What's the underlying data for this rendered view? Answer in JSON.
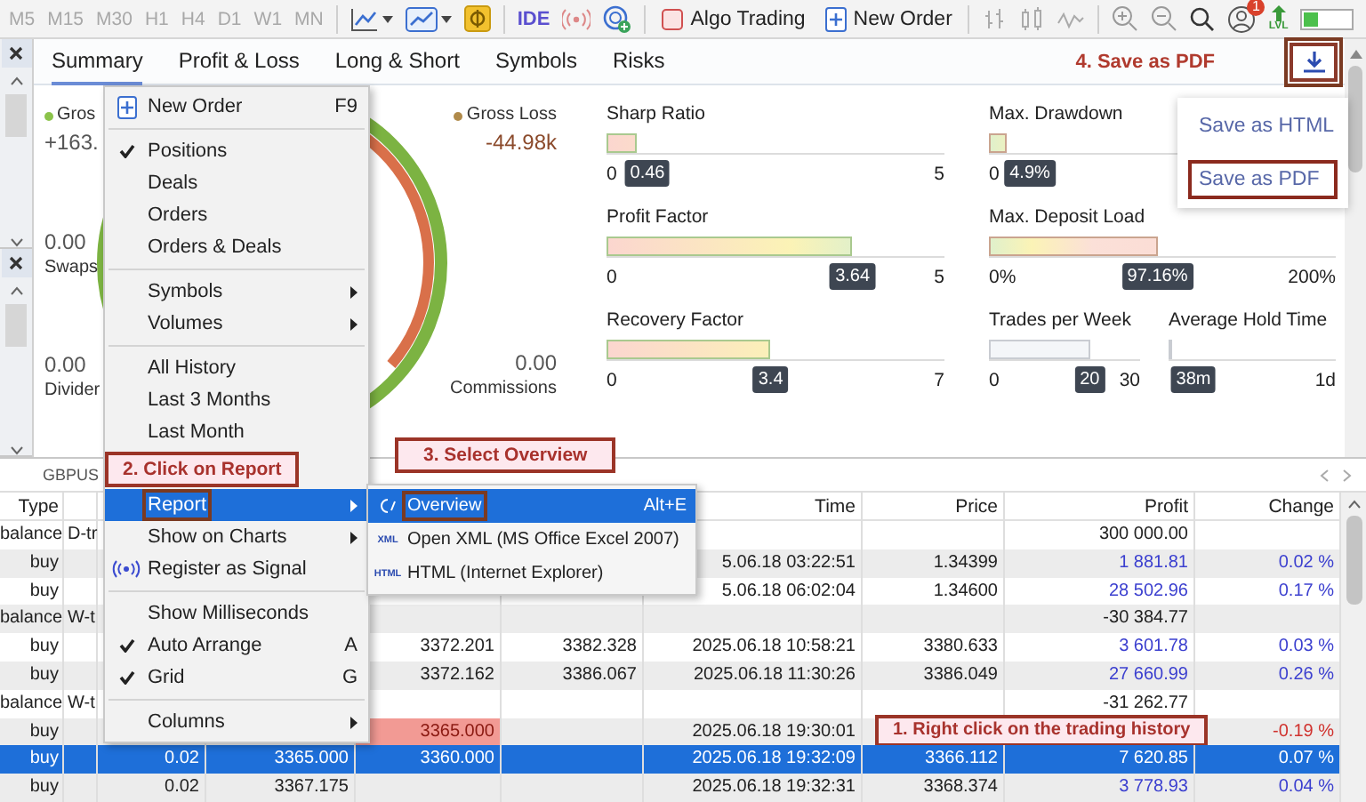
{
  "toolbar": {
    "timeframes": [
      "M5",
      "M15",
      "M30",
      "H1",
      "H4",
      "D1",
      "W1",
      "MN"
    ],
    "ide_label": "IDE",
    "algo_trading": "Algo Trading",
    "new_order": "New Order",
    "notification_count": "1",
    "level_label": "LVL"
  },
  "report": {
    "tabs": [
      {
        "label": "Summary",
        "selected": true
      },
      {
        "label": "Profit & Loss",
        "selected": false
      },
      {
        "label": "Long & Short",
        "selected": false
      },
      {
        "label": "Symbols",
        "selected": false
      },
      {
        "label": "Risks",
        "selected": false
      }
    ],
    "callout": "4. Save as PDF",
    "download_outlined": true,
    "summary": {
      "gross_profit_label": "Gros",
      "gross_profit_value": "+163.",
      "swaps_value": "0.00",
      "swaps_label": "Swaps",
      "dividends_value": "0.00",
      "dividends_label": "Divider",
      "gross_loss_label": "Gross Loss",
      "gross_loss_value": "-44.98k",
      "commissions_value": "0.00",
      "commissions_label": "Commissions"
    },
    "metrics": [
      {
        "label": "Sharp Ratio",
        "value": "0.46",
        "min": "0",
        "max": "5",
        "level": 0.092,
        "kind": "rising"
      },
      {
        "label": "Max. Drawdown",
        "value": "4.9%",
        "min": "0",
        "level": 0.05,
        "kind": "falling"
      },
      {
        "label": "Profit Factor",
        "value": "3.64",
        "min": "0",
        "max": "5",
        "level": 0.728,
        "kind": "rising"
      },
      {
        "label": "Max. Deposit Load",
        "value": "97.16%",
        "min": "0%",
        "max": "200%",
        "level": 0.486,
        "kind": "falling"
      },
      {
        "label": "Recovery Factor",
        "value": "3.4",
        "min": "0",
        "max": "7",
        "level": 0.486,
        "kind": "rising"
      },
      {
        "label": "Trades per Week",
        "value": "20",
        "min": "0",
        "max": "30",
        "level": 0.667,
        "kind": "neutral"
      },
      {
        "label": "Average Hold Time",
        "value": "38m",
        "max": "1d",
        "level": 0.026,
        "kind": "neutral"
      }
    ],
    "save_menu": [
      {
        "label": "Save as HTML",
        "outlined": false
      },
      {
        "label": "Save as PDF",
        "outlined": true
      }
    ]
  },
  "context_menu": [
    {
      "kind": "order_item",
      "label": "New Order",
      "shortcut": "F9",
      "selected": false
    },
    {
      "kind": "separator"
    },
    {
      "kind": "item",
      "label": "Positions",
      "checked": true,
      "selected": false
    },
    {
      "kind": "item",
      "label": "Deals",
      "checked": false,
      "selected": false
    },
    {
      "kind": "item",
      "label": "Orders",
      "checked": false,
      "selected": false
    },
    {
      "kind": "item",
      "label": "Orders & Deals",
      "checked": false,
      "selected": false
    },
    {
      "kind": "separator"
    },
    {
      "kind": "item",
      "label": "Symbols",
      "submenu": true,
      "selected": false
    },
    {
      "kind": "item",
      "label": "Volumes",
      "submenu": true,
      "selected": false
    },
    {
      "kind": "separator"
    },
    {
      "kind": "item",
      "label": "All History",
      "selected": false
    },
    {
      "kind": "item",
      "label": "Last 3 Months",
      "selected": false
    },
    {
      "kind": "item",
      "label": "Last Month",
      "selected": false
    },
    {
      "kind": "callout",
      "label": "2. Click on Report"
    },
    {
      "kind": "item",
      "label": "Report",
      "submenu": true,
      "selected": true,
      "outlined": true
    },
    {
      "kind": "item",
      "label": "Show on Charts",
      "submenu": true,
      "selected": false
    },
    {
      "kind": "signal_item",
      "label": "Register as Signal",
      "selected": false
    },
    {
      "kind": "separator"
    },
    {
      "kind": "item",
      "label": "Show Milliseconds",
      "checked": false,
      "selected": false
    },
    {
      "kind": "item",
      "label": "Auto Arrange",
      "checked": true,
      "shortcut": "A",
      "selected": false
    },
    {
      "kind": "item",
      "label": "Grid",
      "checked": true,
      "shortcut": "G",
      "selected": false
    },
    {
      "kind": "separator"
    },
    {
      "kind": "item",
      "label": "Columns",
      "submenu": true,
      "selected": false
    }
  ],
  "submenu": {
    "callout": "3. Select Overview",
    "items": [
      {
        "kind": "view",
        "label": "Overview",
        "shortcut": "Alt+E",
        "selected": true,
        "outlined": true
      },
      {
        "kind": "export",
        "label": "Open XML (MS Office Excel 2007)",
        "badge": "XML",
        "selected": false,
        "outlined": false
      },
      {
        "kind": "export",
        "label": "HTML (Internet Explorer)",
        "badge": "HTML",
        "selected": false,
        "outlined": false
      }
    ]
  },
  "history": {
    "symbol_tab": "GBPUS",
    "columns": [
      "Type",
      null,
      null,
      null,
      null,
      null,
      "Time",
      "Price",
      "Profit",
      "Change"
    ],
    "rows": [
      {
        "kind": "balance",
        "selected": false,
        "cells": [
          "balance",
          "D-tr",
          null,
          null,
          null,
          null,
          null,
          null,
          "300 000.00",
          null
        ]
      },
      {
        "kind": "buy",
        "selected": false,
        "loss": false,
        "cells": [
          "buy",
          null,
          null,
          null,
          null,
          null,
          "5.06.18 03:22:51",
          "1.34399",
          "1 881.81",
          "0.02 %"
        ]
      },
      {
        "kind": "buy",
        "selected": false,
        "loss": false,
        "cells": [
          "buy",
          null,
          null,
          null,
          null,
          null,
          "5.06.18 06:02:04",
          "1.34600",
          "28 502.96",
          "0.17 %"
        ]
      },
      {
        "kind": "balance",
        "selected": false,
        "cells": [
          "balance",
          "W-t",
          null,
          null,
          null,
          null,
          null,
          null,
          "-30 384.77",
          null
        ]
      },
      {
        "kind": "buy",
        "selected": false,
        "loss": false,
        "cells": [
          "buy",
          null,
          null,
          null,
          "3372.201",
          "3382.328",
          "2025.06.18 10:58:21",
          "3380.633",
          "3 601.78",
          "0.03 %"
        ]
      },
      {
        "kind": "buy",
        "selected": false,
        "loss": false,
        "cells": [
          "buy",
          null,
          null,
          null,
          "3372.162",
          "3386.067",
          "2025.06.18 11:30:26",
          "3386.049",
          "27 660.99",
          "0.26 %"
        ]
      },
      {
        "kind": "balance",
        "selected": false,
        "cells": [
          "balance",
          "W-t",
          null,
          null,
          null,
          null,
          null,
          null,
          "-31 262.77",
          null
        ]
      },
      {
        "kind": "buy",
        "selected": false,
        "loss": true,
        "callout": "1. Right click on the trading history",
        "cells": [
          "buy",
          null,
          null,
          null,
          {
            "text": "3365.000",
            "alert": true
          },
          null,
          "2025.06.18 19:30:01",
          null,
          null,
          "-0.19 %"
        ]
      },
      {
        "kind": "buy",
        "selected": true,
        "loss": false,
        "cells": [
          "buy",
          null,
          "0.02",
          "3365.000",
          "3360.000",
          null,
          "2025.06.18 19:32:09",
          "3366.112",
          "7 620.85",
          "0.07 %"
        ]
      },
      {
        "kind": "buy",
        "selected": false,
        "loss": false,
        "cells": [
          "buy",
          null,
          "0.02",
          "3367.175",
          null,
          null,
          "2025.06.18 19:32:31",
          "3368.374",
          "3 778.93",
          "0.04 %"
        ]
      }
    ]
  }
}
